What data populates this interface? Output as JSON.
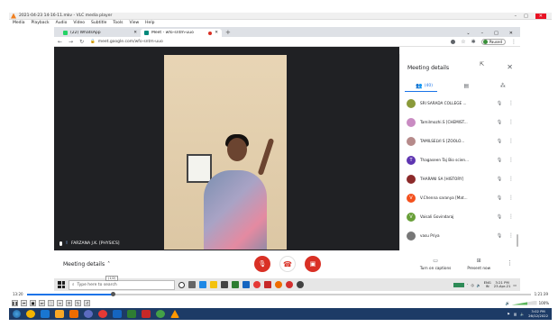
{
  "vlc": {
    "title": "2021-04-23 14-16-11.mkv - VLC media player",
    "window_controls": [
      "–",
      "□",
      "✕"
    ],
    "menu": [
      "Media",
      "Playback",
      "Audio",
      "Video",
      "Subtitle",
      "Tools",
      "View",
      "Help"
    ],
    "time_elapsed": "13:20",
    "time_total": "1:21:39",
    "progress_fraction": 0.17,
    "volume_label": "100%",
    "volume_fraction": 0.6
  },
  "chrome": {
    "tabs": [
      {
        "label": "(22) WhatsApp",
        "favicon_color": "#25d366",
        "active": false
      },
      {
        "label": "Meet - wfo-sntm-uuo",
        "favicon_color": "#00897b",
        "active": true,
        "recording": true
      }
    ],
    "new_tab": "+",
    "window_controls": [
      "–",
      "□",
      "✕"
    ],
    "url": "meet.google.com/wfo-sntm-uuo",
    "profile_status": "Paused"
  },
  "meet": {
    "presenter_name": "FARZANA J.K. [PHYSICS]",
    "panel": {
      "title": "Meeting details",
      "tabs": [
        {
          "icon": "people-icon",
          "label": "(40)",
          "active": true
        },
        {
          "icon": "chat-icon",
          "label": "",
          "active": false
        },
        {
          "icon": "activities-icon",
          "label": "",
          "active": false
        }
      ],
      "participants": [
        {
          "name": "SRI SARADA COLLEGE ...",
          "initial": "",
          "color": "#8a9a3a"
        },
        {
          "name": "Tamilmozhi.S [CHEMIST...",
          "initial": "",
          "color": "#c98bc2"
        },
        {
          "name": "TAMILSELVI S [ZOOLO...",
          "initial": "",
          "color": "#b68a8a"
        },
        {
          "name": "Thagaseen Taj Bio scien...",
          "initial": "T",
          "color": "#5e35b1"
        },
        {
          "name": "THARANI SA [HISTORY]",
          "initial": "",
          "color": "#8c2a2a"
        },
        {
          "name": "V.Chenna saranya [Mat...",
          "initial": "V",
          "color": "#f4511e"
        },
        {
          "name": "Vaisali Govindaraj",
          "initial": "V",
          "color": "#689f38"
        },
        {
          "name": "vasu Priya",
          "initial": "",
          "color": "#777777"
        },
        {
          "name": "",
          "initial": "",
          "color": "#e57373"
        }
      ]
    },
    "controls": {
      "details_label": "Meeting details",
      "captions_label": "Turn on captions",
      "present_label": "Present now"
    }
  },
  "inner_taskbar": {
    "search_placeholder": "Type here to search",
    "search_tip": "(1/2)",
    "time": "3:21 PM",
    "date": "23-Apr-21",
    "lang_primary": "ENG",
    "lang_secondary": "IN"
  },
  "host_taskbar": {
    "time": "3:02 PM",
    "date": "26/12/2022"
  }
}
